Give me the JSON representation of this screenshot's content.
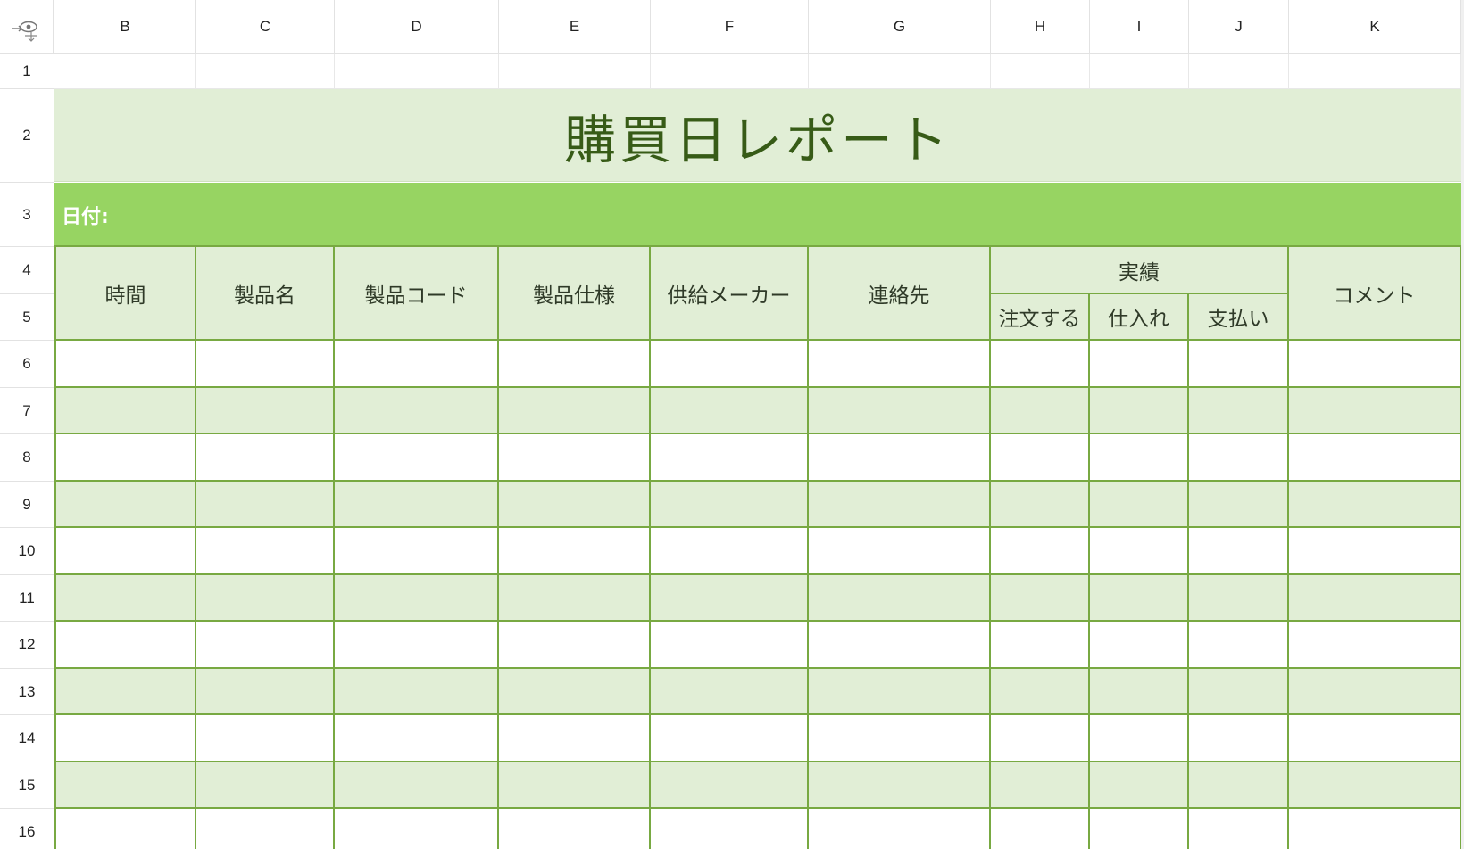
{
  "columns": [
    "B",
    "C",
    "D",
    "E",
    "F",
    "G",
    "H",
    "I",
    "J",
    "K"
  ],
  "rows": [
    "1",
    "2",
    "3",
    "4",
    "5",
    "6",
    "7",
    "8",
    "9",
    "10",
    "11",
    "12",
    "13",
    "14",
    "15",
    "16"
  ],
  "sheet": {
    "title": "購買日レポート",
    "date_label": "日付:",
    "headers": {
      "time": "時間",
      "product_name": "製品名",
      "product_code": "製品コード",
      "product_spec": "製品仕様",
      "supplier": "供給メーカー",
      "contact": "連絡先",
      "performance": "実績",
      "order": "注文する",
      "purchase": "仕入れ",
      "payment": "支払い",
      "comment": "コメント"
    }
  },
  "icons": {
    "corner": "eye-icon"
  },
  "colors": {
    "header_fill": "#e1eed6",
    "date_band": "#97d462",
    "border": "#78a942",
    "title_text": "#375b17"
  }
}
